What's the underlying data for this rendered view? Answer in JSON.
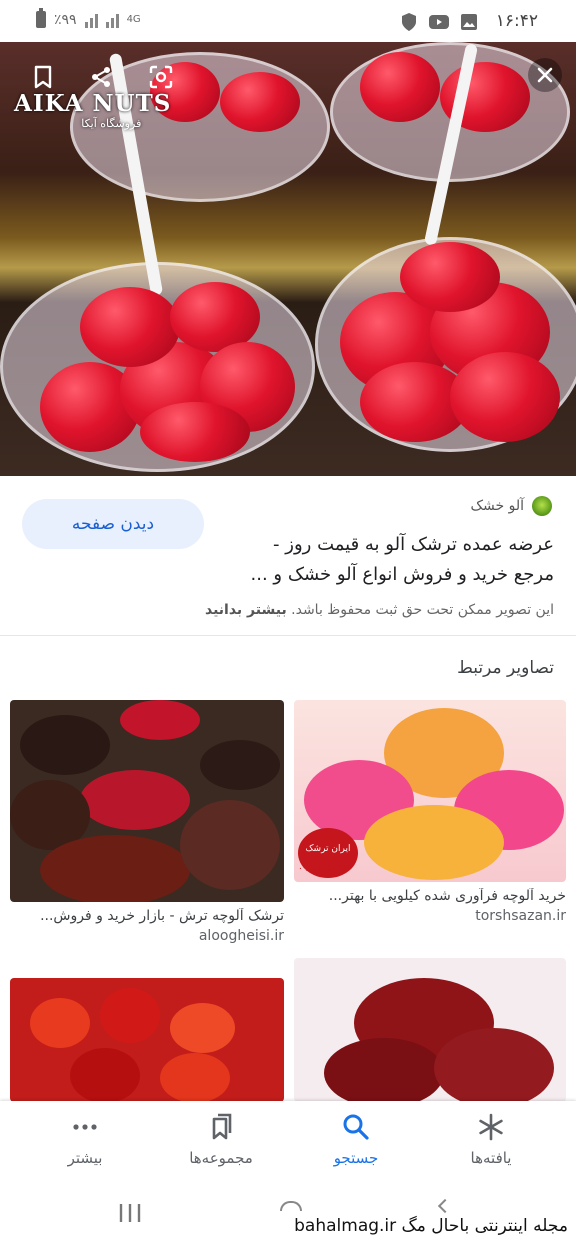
{
  "status_bar": {
    "time": "۱۶:۴۲",
    "battery": "٪۹۹",
    "network": "4G"
  },
  "hero": {
    "logo_text": "AIKA NUTS",
    "logo_subtext": "فروشگاه آیکا"
  },
  "result": {
    "source_name": "آلو خشک",
    "title": "عرضه عمده ترشک آلو به قیمت روز - مرجع خرید و فروش انواع آلو خشک و ...",
    "visit_label": "دیدن صفحه",
    "notice_text": "این تصویر ممکن تحت حق ثبت محفوظ باشد.",
    "notice_link": "بیشتر بدانید"
  },
  "related": {
    "heading": "تصاویر مرتبط",
    "items": [
      {
        "caption": "خرید آلوچه فرآوری شده کیلویی با بهتر...",
        "site": "torshsazan.ir",
        "badge_text": "ایران ترشک",
        "badge_phone": "۰۹۱۵۶۱۵۲۲۵۲"
      },
      {
        "caption": "ترشک آلوچه ترش - بازار خرید و فروش...",
        "site": "aloogheisi.ir"
      },
      {
        "caption": "",
        "site": ""
      },
      {
        "caption": "",
        "site": ""
      }
    ]
  },
  "bottom_nav": {
    "items": [
      {
        "label": "یافته‌ها",
        "icon": "asterisk-icon"
      },
      {
        "label": "جستجو",
        "icon": "search-icon"
      },
      {
        "label": "مجموعه‌ها",
        "icon": "bookmarks-icon"
      },
      {
        "label": "بیشتر",
        "icon": "more-icon"
      }
    ],
    "active": "جستجو"
  },
  "watermark": "مجله اینترنتی باحال مگ bahalmag.ir",
  "colors": {
    "accent": "#1a73e8",
    "visit_bg": "#e8f0fe"
  }
}
